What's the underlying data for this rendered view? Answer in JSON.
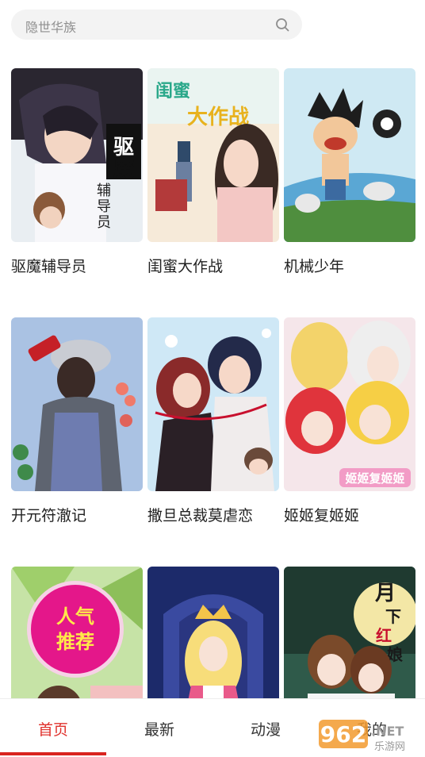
{
  "search": {
    "placeholder": "隐世华族",
    "icon": "search-icon"
  },
  "comics": [
    {
      "title": "驱魔辅导员",
      "cover_text": "驱魔辅导员",
      "accent": "#2b2b3a"
    },
    {
      "title": "闺蜜大作战",
      "cover_text": "闺蜜大作战",
      "accent": "#f4c7c0"
    },
    {
      "title": "机械少年",
      "accent": "#4ba3d6"
    },
    {
      "title": "开元符澈记",
      "accent": "#6f93c8"
    },
    {
      "title": "撒旦总裁莫虐恋",
      "accent": "#b3263a"
    },
    {
      "title": "姬姬复姬姬",
      "cover_text": "姬姬复姬姬",
      "accent": "#f0d9de"
    },
    {
      "title": "",
      "badge": "人气推荐",
      "accent": "#9fcf6b"
    },
    {
      "title": "",
      "accent": "#2f3a7a"
    },
    {
      "title": "",
      "cover_text": "月下红娘",
      "accent": "#3b6a5a"
    }
  ],
  "tabs": [
    {
      "label": "首页",
      "active": true
    },
    {
      "label": "最新"
    },
    {
      "label": "动漫"
    },
    {
      "label": "我的"
    }
  ],
  "watermark": {
    "text": "962",
    "suffix": ".NET",
    "sub": "乐游网"
  },
  "colors": {
    "active": "#e0312c",
    "indicator": "#d9241f"
  }
}
